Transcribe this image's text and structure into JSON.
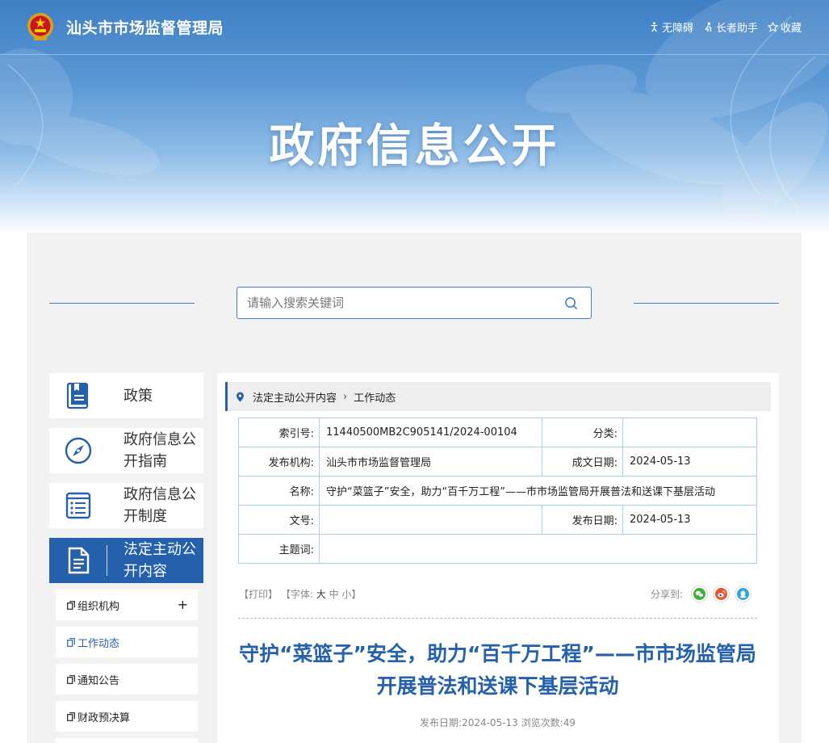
{
  "header": {
    "site_name": "汕头市市场监督管理局",
    "tools": [
      {
        "label": "无障碍",
        "icon": "accessibility-icon"
      },
      {
        "label": "长者助手",
        "icon": "elder-helper-icon"
      },
      {
        "label": "收藏",
        "icon": "star-icon"
      }
    ],
    "banner_title": "政府信息公开"
  },
  "search": {
    "placeholder": "请输入搜索关键词",
    "value": ""
  },
  "sidebar": {
    "items": [
      {
        "label": "政策",
        "icon": "policy-book-icon"
      },
      {
        "label": "政府信息公开指南",
        "icon": "compass-icon"
      },
      {
        "label": "政府信息公开制度",
        "icon": "list-document-icon"
      },
      {
        "label": "法定主动公开内容",
        "icon": "document-icon",
        "active": true
      }
    ],
    "sub_items": [
      {
        "label": "组织机构",
        "expand": "+"
      },
      {
        "label": "工作动态",
        "active": true
      },
      {
        "label": "通知公告"
      },
      {
        "label": "财政预决算"
      }
    ]
  },
  "breadcrumb": {
    "parent": "法定主动公开内容",
    "current": "工作动态"
  },
  "meta": {
    "index_label": "索引号:",
    "index_value": "11440500MB2C905141/2024-00104",
    "category_label": "分类:",
    "category_value": "",
    "issuer_label": "发布机构:",
    "issuer_value": "汕头市市场监督管理局",
    "created_label": "成文日期:",
    "created_value": "2024-05-13",
    "name_label": "名称:",
    "name_value": "守护“菜篮子”安全，助力“百千万工程”——市市场监管局开展普法和送课下基层活动",
    "docno_label": "文号:",
    "docno_value": "",
    "published_label": "发布日期:",
    "published_value": "2024-05-13",
    "subject_label": "主题词:",
    "subject_value": ""
  },
  "toolbar": {
    "print": "【打印】",
    "font_prefix": "【字体:",
    "font_large": "大",
    "font_medium": "中",
    "font_small": "小",
    "font_suffix": "】",
    "share_label": "分享到:"
  },
  "article": {
    "title": "守护“菜篮子”安全，助力“百千万工程”——市市场监管局开展普法和送课下基层活动",
    "date_label": "发布日期:",
    "date": "2024-05-13",
    "views_label": "浏览次数:",
    "views": "49"
  },
  "colors": {
    "brand": "#2460ac",
    "accent_line": "#3c7fc8",
    "table_border": "#aacfe0"
  }
}
